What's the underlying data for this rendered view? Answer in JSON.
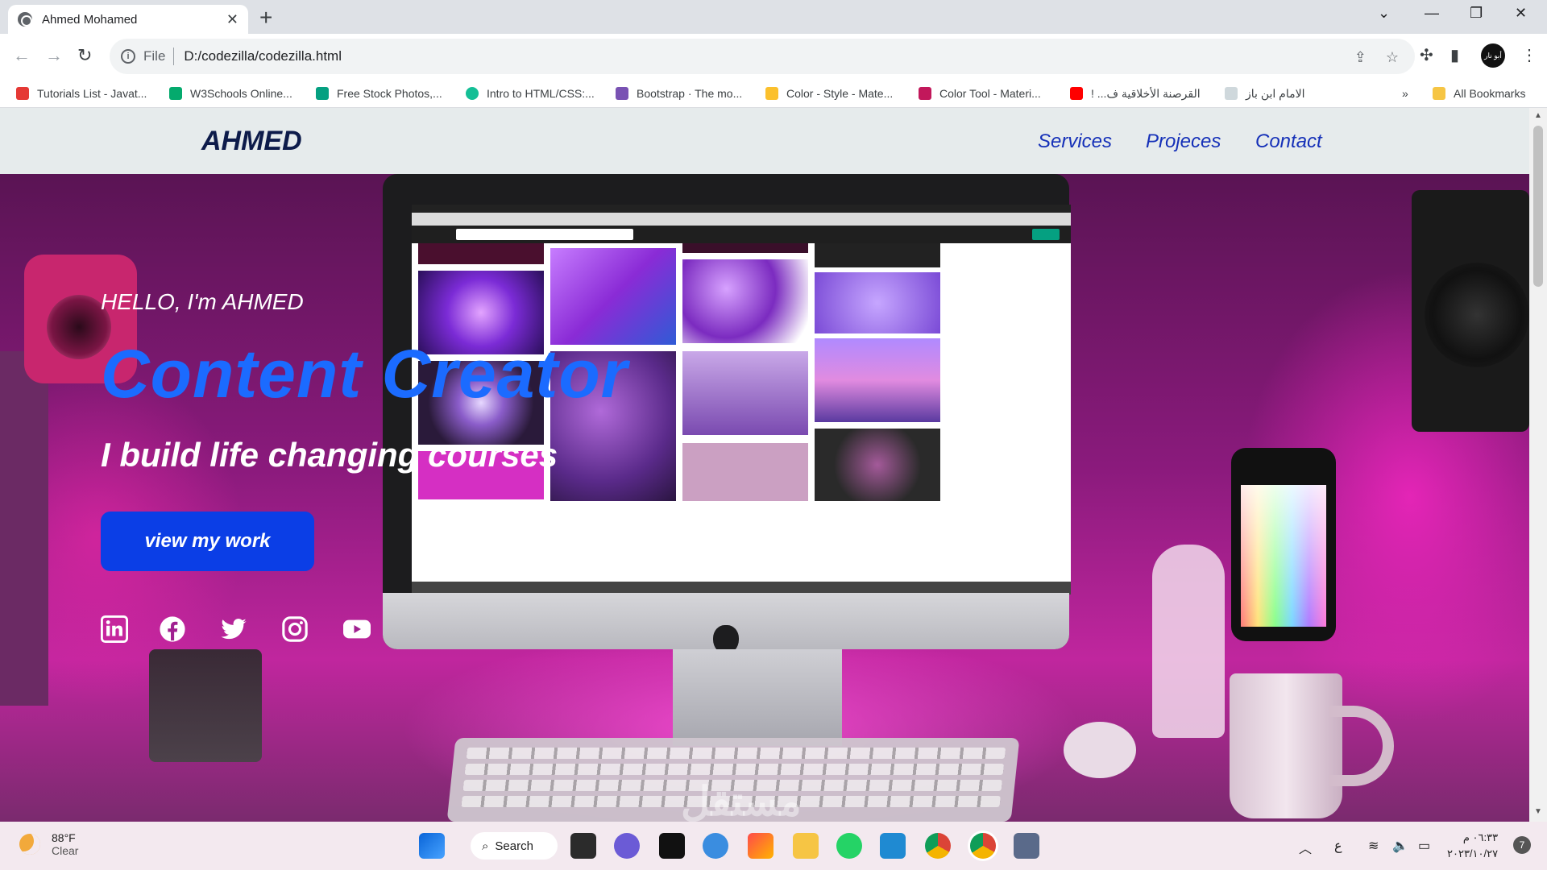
{
  "browser": {
    "tab_title": "Ahmed Mohamed",
    "tab_close": "✕",
    "new_tab": "+",
    "window_controls": [
      "⌄",
      "—",
      "❐",
      "✕"
    ],
    "nav": {
      "back": "←",
      "forward": "→",
      "reload": "↻"
    },
    "omnibox": {
      "protocol": "File",
      "url": "D:/codezilla/codezilla.html",
      "info": "i"
    },
    "profile_label": "أبو نار",
    "bookmarks": [
      {
        "label": "Tutorials List - Javat...",
        "icon": "javatpoint-icon",
        "color": "#e53935"
      },
      {
        "label": "W3Schools Online...",
        "icon": "w3schools-icon",
        "color": "#04aa6d"
      },
      {
        "label": "Free Stock Photos,...",
        "icon": "pexels-icon",
        "color": "#05a081"
      },
      {
        "label": "Intro to HTML/CSS:...",
        "icon": "khan-academy-icon",
        "color": "#14bf96"
      },
      {
        "label": "Bootstrap · The mo...",
        "icon": "bootstrap-icon",
        "color": "#7952b3"
      },
      {
        "label": "Color - Style - Mate...",
        "icon": "material-icon",
        "color": "#fbc02d"
      },
      {
        "label": "Color Tool - Materi...",
        "icon": "material-color-tool-icon",
        "color": "#c2185b"
      },
      {
        "label": "القرصنة الأخلاقية ف... !",
        "icon": "youtube-icon",
        "color": "#ff0000"
      },
      {
        "label": "الامام ابن باز",
        "icon": "ibnbaz-icon",
        "color": "#cfd8dc"
      }
    ],
    "bookmarks_overflow": "»",
    "all_bookmarks": "All Bookmarks"
  },
  "site": {
    "logo": "AHMED",
    "nav": [
      "Services",
      "Projeces",
      "Contact"
    ],
    "hero": {
      "greeting": "HELLO, I'm AHMED",
      "headline": "Content Creator",
      "subline": "I build life changing courses",
      "cta": "view my work"
    },
    "social": [
      "linkedin-icon",
      "facebook-icon",
      "twitter-icon",
      "instagram-icon",
      "youtube-icon"
    ],
    "watermark": "مستقل"
  },
  "taskbar": {
    "weather_temp": "88°F",
    "weather_desc": "Clear",
    "search_label": "Search",
    "tray_lang": "ع",
    "time": "٠٦:٣٣ م",
    "date": "٢٠٢٣/١٠/٢٧",
    "notifications": "7"
  }
}
